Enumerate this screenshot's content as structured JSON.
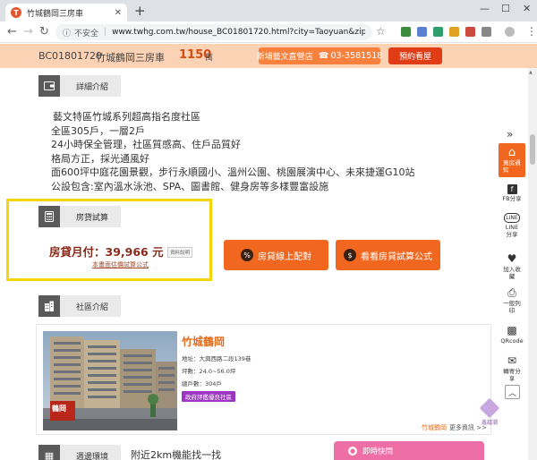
{
  "browser": {
    "tab_title": "竹城鶴岡三房車",
    "tab_favicon": "T",
    "new_tab": "+",
    "insecure_label": "不安全",
    "url": "www.twhg.com.tw/house_BC01801720.html?city=Taoyuan&zip=330&typ...",
    "win_min": "—",
    "win_max": "☐",
    "win_close": "✕"
  },
  "header": {
    "listing_id": "BC01801720",
    "listing_name": "竹城鶴岡三房車",
    "price": "1150",
    "price_unit": "萬",
    "store_label": "新埔藝文直營店",
    "store_phone": "03-3581518",
    "book_label": "預約看屋"
  },
  "details": {
    "section_label": "詳細介紹",
    "lines": [
      "藝文特區竹城系列超高指名度社區",
      "全區305戶，一層2戶",
      "24小時保全管理，社區質感高、住戶品質好",
      "格局方正，採光通風好",
      "面600坪中庭花園景觀，步行永順國小、溫州公園、桃園展演中心、未來捷運G10站",
      "公設包含:室內溫水泳池、SPA、圖書館、健身房等多樣豐富設施"
    ]
  },
  "calculator": {
    "section_label": "房貸試算",
    "monthly_label": "房貸月付：",
    "monthly_value": "39,966 元",
    "note": "資料說明",
    "link": "本畫面估價試算公式",
    "btn_online": "房貸線上配對",
    "btn_formula": "看看房貸試算公式"
  },
  "community": {
    "section_label": "社區介紹",
    "name": "竹城鶴岡",
    "address": "地址：大興西路二段139巷",
    "size": "坪數：24.0~56.0坪",
    "units": "總戶數：304戶",
    "badge": "政府評鑑優良社區",
    "footer_name": "竹城鶴岡",
    "footer_more": "更多資訊 >>",
    "sign_text": "鶴岡"
  },
  "environment": {
    "section_label": "週邊環境",
    "title": "附近2km機能找一找"
  },
  "chat": {
    "label": "即時快問"
  },
  "sidebar": {
    "toggle": "»",
    "items": [
      {
        "label": "買房通知",
        "icon": "house-icon"
      },
      {
        "label": "FB分享",
        "icon": "facebook-icon"
      },
      {
        "label": "LINE分享",
        "icon": "line-icon"
      },
      {
        "label": "加入收藏",
        "icon": "heart-icon"
      },
      {
        "label": "一般列印",
        "icon": "printer-icon"
      },
      {
        "label": "QRcode",
        "icon": "qrcode-icon"
      },
      {
        "label": "轉寄分享",
        "icon": "mail-icon"
      }
    ],
    "top_label": "︿"
  },
  "watermark": {
    "text": "鑫譜潮"
  },
  "colors": {
    "header_bg": "#fcd2b4",
    "accent_orange": "#f2671f",
    "book_red": "#e03d16",
    "highlight_yellow": "#f5d40a",
    "badge_purple": "#9b35c2",
    "chat_pink": "#ee6fa6"
  }
}
